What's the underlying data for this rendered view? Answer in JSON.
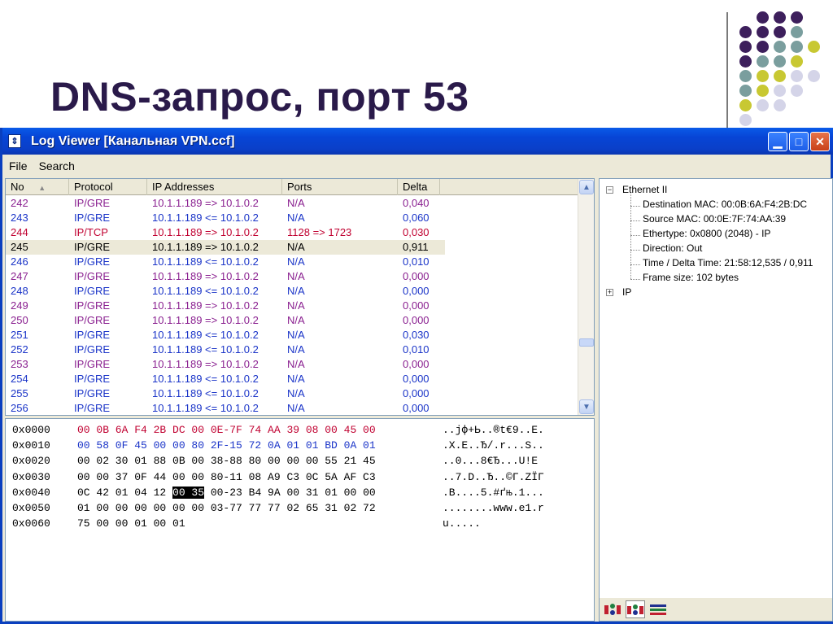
{
  "slide": {
    "title": "DNS-запрос, порт 53"
  },
  "decor_colors": {
    "purple": "#3d1f5c",
    "teal": "#7a9e9e",
    "olive": "#c8c832",
    "lavender": "#d4d4e8"
  },
  "window": {
    "title": "Log Viewer [Канальная VPN.ccf]",
    "icon": "app-arrows-icon",
    "controls": [
      "minimize",
      "maximize",
      "close"
    ]
  },
  "menu": {
    "items": [
      "File",
      "Search"
    ]
  },
  "packet_list": {
    "columns": [
      "No",
      "Protocol",
      "IP Addresses",
      "Ports",
      "Delta"
    ],
    "sort_indicator": "▲",
    "selected_row": 3,
    "rows": [
      {
        "no": "242",
        "protocol": "IP/GRE",
        "ip": "10.1.1.189 => 10.1.0.2",
        "ports": "N/A",
        "delta": "0,040",
        "color": "purple"
      },
      {
        "no": "243",
        "protocol": "IP/GRE",
        "ip": "10.1.1.189 <= 10.1.0.2",
        "ports": "N/A",
        "delta": "0,060",
        "color": "blue"
      },
      {
        "no": "244",
        "protocol": "IP/TCP",
        "ip": "10.1.1.189 => 10.1.0.2",
        "ports": "1128 => 1723",
        "delta": "0,030",
        "color": "red"
      },
      {
        "no": "245",
        "protocol": "IP/GRE",
        "ip": "10.1.1.189 => 10.1.0.2",
        "ports": "N/A",
        "delta": "0,911",
        "color": "gray"
      },
      {
        "no": "246",
        "protocol": "IP/GRE",
        "ip": "10.1.1.189 <= 10.1.0.2",
        "ports": "N/A",
        "delta": "0,010",
        "color": "blue"
      },
      {
        "no": "247",
        "protocol": "IP/GRE",
        "ip": "10.1.1.189 => 10.1.0.2",
        "ports": "N/A",
        "delta": "0,000",
        "color": "purple"
      },
      {
        "no": "248",
        "protocol": "IP/GRE",
        "ip": "10.1.1.189 <= 10.1.0.2",
        "ports": "N/A",
        "delta": "0,000",
        "color": "blue"
      },
      {
        "no": "249",
        "protocol": "IP/GRE",
        "ip": "10.1.1.189 => 10.1.0.2",
        "ports": "N/A",
        "delta": "0,000",
        "color": "purple"
      },
      {
        "no": "250",
        "protocol": "IP/GRE",
        "ip": "10.1.1.189 => 10.1.0.2",
        "ports": "N/A",
        "delta": "0,000",
        "color": "purple"
      },
      {
        "no": "251",
        "protocol": "IP/GRE",
        "ip": "10.1.1.189 <= 10.1.0.2",
        "ports": "N/A",
        "delta": "0,030",
        "color": "blue"
      },
      {
        "no": "252",
        "protocol": "IP/GRE",
        "ip": "10.1.1.189 <= 10.1.0.2",
        "ports": "N/A",
        "delta": "0,010",
        "color": "blue"
      },
      {
        "no": "253",
        "protocol": "IP/GRE",
        "ip": "10.1.1.189 => 10.1.0.2",
        "ports": "N/A",
        "delta": "0,000",
        "color": "purple"
      },
      {
        "no": "254",
        "protocol": "IP/GRE",
        "ip": "10.1.1.189 <= 10.1.0.2",
        "ports": "N/A",
        "delta": "0,000",
        "color": "blue"
      },
      {
        "no": "255",
        "protocol": "IP/GRE",
        "ip": "10.1.1.189 <= 10.1.0.2",
        "ports": "N/A",
        "delta": "0,000",
        "color": "blue"
      },
      {
        "no": "256",
        "protocol": "IP/GRE",
        "ip": "10.1.1.189 <= 10.1.0.2",
        "ports": "N/A",
        "delta": "0,000",
        "color": "blue"
      }
    ]
  },
  "hex_dump": {
    "selected": {
      "row": 4,
      "text": "00 35"
    },
    "rows": [
      {
        "offset": "0x0000",
        "bytes_pre": "00 0B 6A F4 2B DC 00 0E-7F 74 AA 39 08 00 45 00",
        "bytes_sel": "",
        "bytes_post": "",
        "ascii": "..jф+Ь..®t€9..E.",
        "byte_color": "#c00030"
      },
      {
        "offset": "0x0010",
        "bytes_pre": "00 58 0F 45 00 00 80 2F-15 72 0A 01 01 BD 0A 01",
        "bytes_sel": "",
        "bytes_post": "",
        "ascii": ".X.E..Ђ/.r...Ѕ..",
        "byte_color": "#1a34c8"
      },
      {
        "offset": "0x0020",
        "bytes_pre": "00 02 30 01 88 0B 00 38-88 80 00 00 00 55 21 45",
        "bytes_sel": "",
        "bytes_post": "",
        "ascii": "..0...8€Ђ...U!E",
        "byte_color": "#000000"
      },
      {
        "offset": "0x0030",
        "bytes_pre": "00 00 37 0F 44 00 00 80-11 08 A9 C3 0C 5A AF C3",
        "bytes_sel": "",
        "bytes_post": "",
        "ascii": "..7.D..Ђ..©Г.ZЇГ",
        "byte_color": "#000000"
      },
      {
        "offset": "0x0040",
        "bytes_pre": "0C 42 01 04 12 ",
        "bytes_sel": "00 35",
        "bytes_post": " 00-23 B4 9A 00 31 01 00 00",
        "ascii": ".B....5.#ґњ.1...",
        "byte_color": "#000000"
      },
      {
        "offset": "0x0050",
        "bytes_pre": "01 00 00 00 00 00 00 03-77 77 77 02 65 31 02 72",
        "bytes_sel": "",
        "bytes_post": "",
        "ascii": "........www.e1.r",
        "byte_color": "#000000"
      },
      {
        "offset": "0x0060",
        "bytes_pre": "75 00 00 01 00 01",
        "bytes_sel": "",
        "bytes_post": "",
        "ascii": "u.....",
        "byte_color": "#000000"
      }
    ]
  },
  "packet_tree": {
    "nodes": [
      {
        "label": "Ethernet II",
        "expander": "−",
        "level": 0
      },
      {
        "label": "Destination MAC: 00:0B:6A:F4:2B:DC",
        "level": 1
      },
      {
        "label": "Source MAC: 00:0E:7F:74:AA:39",
        "level": 1
      },
      {
        "label": "Ethertype: 0x0800 (2048) - IP",
        "level": 1
      },
      {
        "label": "Direction: Out",
        "level": 1
      },
      {
        "label": "Time / Delta Time: 21:58:12,535 / 0,911",
        "level": 1
      },
      {
        "label": "Frame size: 102 bytes",
        "level": 1
      },
      {
        "label": "IP",
        "expander": "+",
        "level": 0
      }
    ],
    "toolbar_icons": [
      "view-mode-1-icon",
      "view-mode-2-icon",
      "view-list-icon"
    ]
  }
}
